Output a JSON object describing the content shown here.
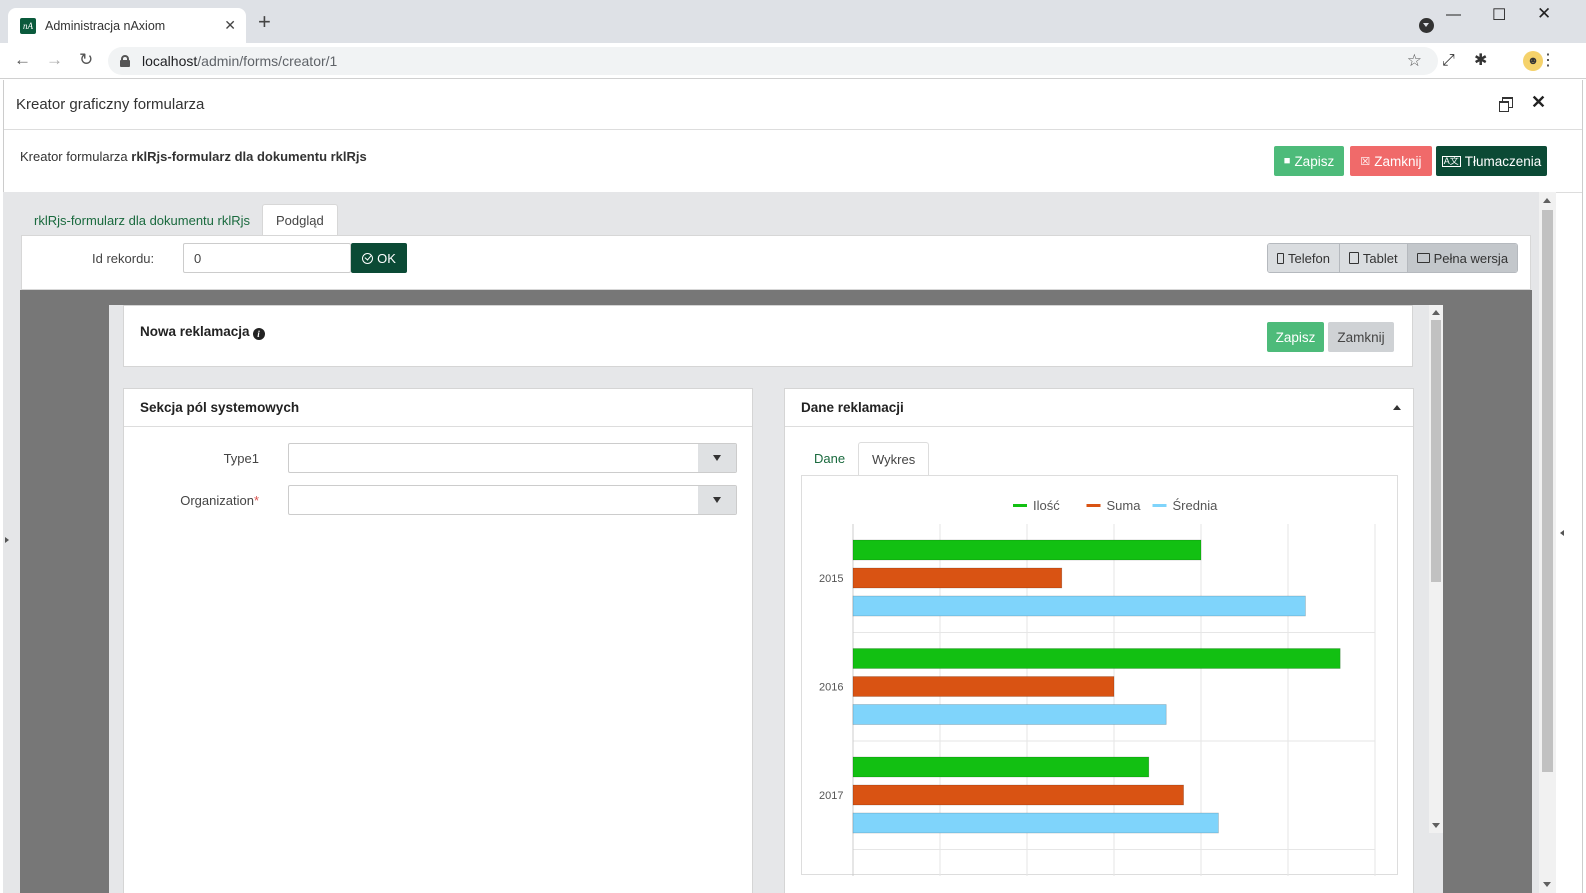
{
  "browser": {
    "tab_title": "Administracja nAxiom",
    "favicon_text": "nA",
    "url_host": "localhost",
    "url_path": "/admin/forms/creator/1"
  },
  "dialog": {
    "title": "Kreator graficzny formularza",
    "crumb_prefix": "Kreator formularza ",
    "crumb_name": "rklRjs-formularz dla dokumentu rklRjs",
    "buttons": {
      "save": "Zapisz",
      "close": "Zamknij",
      "translations": "Tłumaczenia"
    },
    "colors": {
      "save": "#4dbb7a",
      "close": "#f06a6a",
      "translations": "#0b4a35"
    }
  },
  "editor": {
    "tabs": [
      "rklRjs-formularz dla dokumentu rklRjs",
      "Podgląd"
    ],
    "active_tab": "Podgląd",
    "record_id_label": "Id rekordu:",
    "record_id_value": "0",
    "ok_label": "OK",
    "devices": [
      "Telefon",
      "Tablet",
      "Pełna wersja"
    ],
    "active_device": "Pełna wersja"
  },
  "form": {
    "title": "Nowa reklamacja",
    "save_label": "Zapisz",
    "close_label": "Zamknij",
    "system_section": {
      "title": "Sekcja pól systemowych",
      "fields": [
        {
          "label": "Type1",
          "required": false,
          "value": ""
        },
        {
          "label": "Organization",
          "required": true,
          "value": ""
        }
      ]
    },
    "complaint_section": {
      "title": "Dane reklamacji",
      "tabs": [
        "Dane",
        "Wykres"
      ],
      "active_tab": "Wykres"
    }
  },
  "chart_data": {
    "type": "bar",
    "orientation": "horizontal",
    "categories": [
      "2015",
      "2016",
      "2017"
    ],
    "series": [
      {
        "name": "Ilość",
        "color": "#12c012",
        "values": [
          20,
          28,
          17
        ]
      },
      {
        "name": "Suma",
        "color": "#d95313",
        "values": [
          12,
          15,
          19
        ]
      },
      {
        "name": "Średnia",
        "color": "#7fd4fb",
        "values": [
          26,
          18,
          21
        ]
      }
    ],
    "xlim": [
      0,
      30
    ],
    "grid": true,
    "legend": "top"
  }
}
